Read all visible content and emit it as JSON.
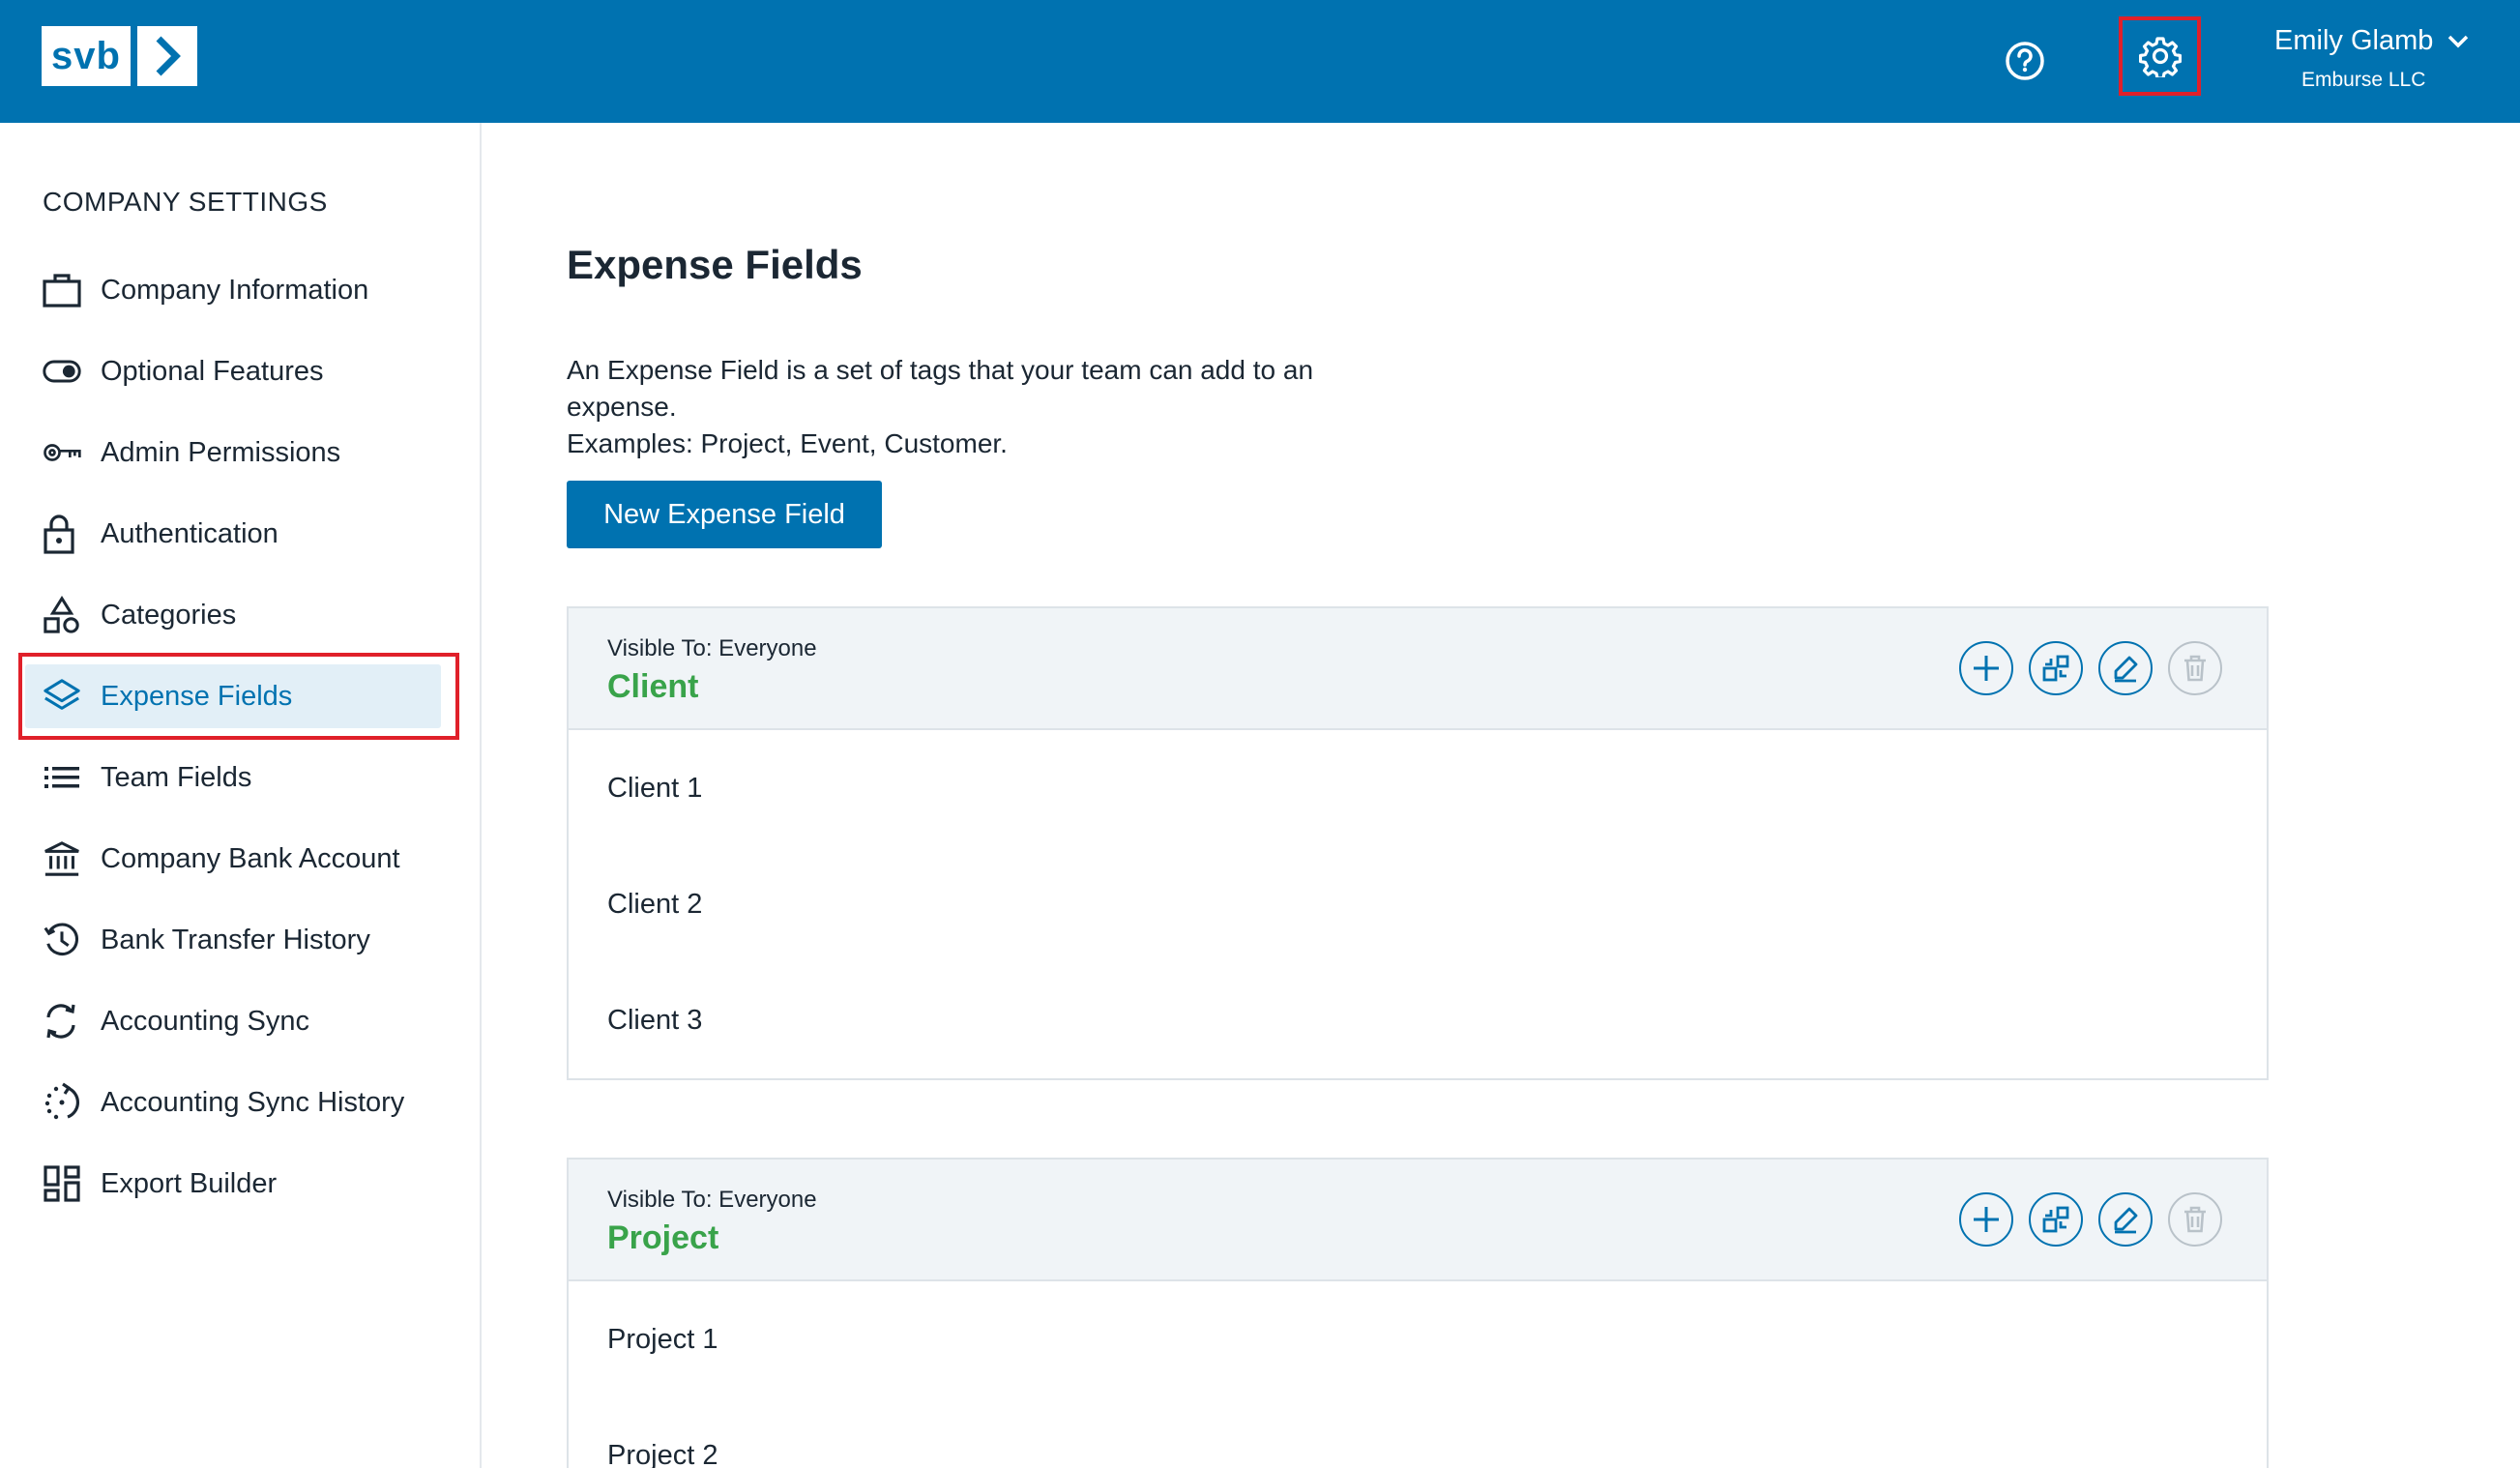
{
  "header": {
    "logo_text": "svb",
    "user_name": "Emily Glamb",
    "user_company": "Emburse LLC",
    "brand_color": "#0072b0",
    "icons": [
      "help-icon",
      "gear-icon",
      "chevron-down-icon"
    ]
  },
  "sidebar": {
    "heading": "COMPANY SETTINGS",
    "items": [
      {
        "label": "Company Information",
        "icon": "briefcase-icon"
      },
      {
        "label": "Optional Features",
        "icon": "toggle-icon"
      },
      {
        "label": "Admin Permissions",
        "icon": "key-icon"
      },
      {
        "label": "Authentication",
        "icon": "lock-icon"
      },
      {
        "label": "Categories",
        "icon": "shapes-icon"
      },
      {
        "label": "Expense Fields",
        "icon": "layers-icon",
        "active": true
      },
      {
        "label": "Team Fields",
        "icon": "list-icon"
      },
      {
        "label": "Company Bank Account",
        "icon": "bank-icon"
      },
      {
        "label": "Bank Transfer History",
        "icon": "history-icon"
      },
      {
        "label": "Accounting Sync",
        "icon": "sync-icon"
      },
      {
        "label": "Accounting Sync History",
        "icon": "sync-history-icon"
      },
      {
        "label": "Export Builder",
        "icon": "grid-icon"
      }
    ]
  },
  "main": {
    "title": "Expense Fields",
    "intro_line1": "An Expense Field is a set of tags that your team can add to an expense.",
    "intro_line2": "Examples: Project, Event, Customer.",
    "new_button": "New Expense Field",
    "fields": [
      {
        "visibility": "Visible To: Everyone",
        "name": "Client",
        "tags": [
          "Client 1",
          "Client 2",
          "Client 3"
        ]
      },
      {
        "visibility": "Visible To: Everyone",
        "name": "Project",
        "tags": [
          "Project 1",
          "Project 2"
        ]
      }
    ],
    "accent_green": "#39a34a"
  }
}
